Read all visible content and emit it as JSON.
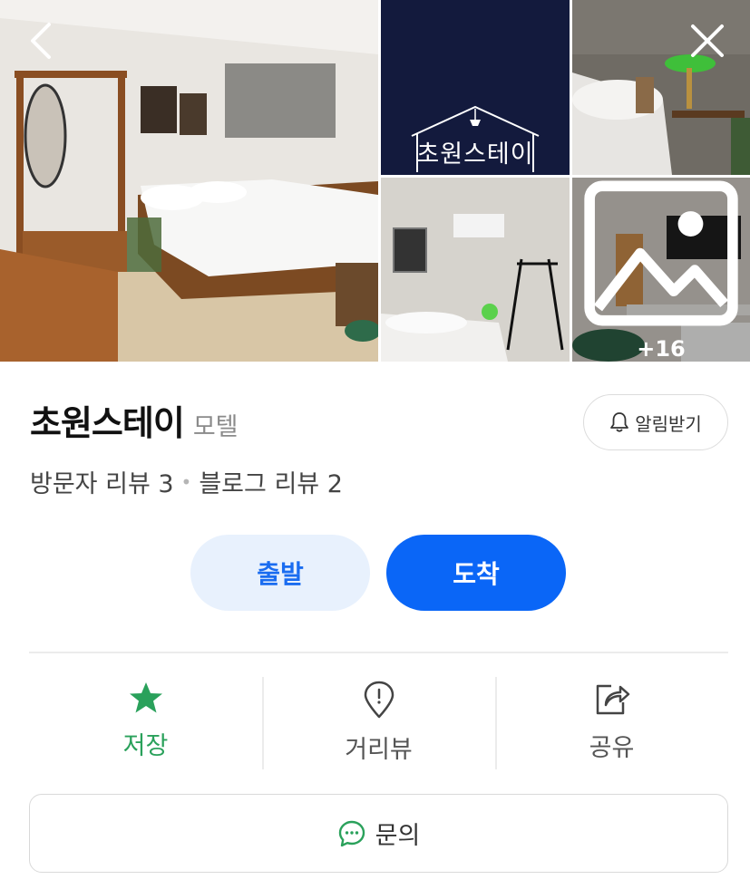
{
  "gallery": {
    "logo_text": "초원스테이",
    "more_count": "+16"
  },
  "place": {
    "name": "초원스테이",
    "category": "모텔",
    "alarm_label": "알림받기",
    "visitor_reviews": "방문자 리뷰 3",
    "blog_reviews": "블로그 리뷰 2"
  },
  "directions": {
    "start_label": "출발",
    "arrive_label": "도착"
  },
  "actions": {
    "save_label": "저장",
    "street_view_label": "거리뷰",
    "share_label": "공유"
  },
  "inquiry": {
    "label": "문의"
  },
  "colors": {
    "primary": "#0a66f7",
    "primary_light": "#e8f1fd",
    "saved_green": "#2aa15b"
  }
}
